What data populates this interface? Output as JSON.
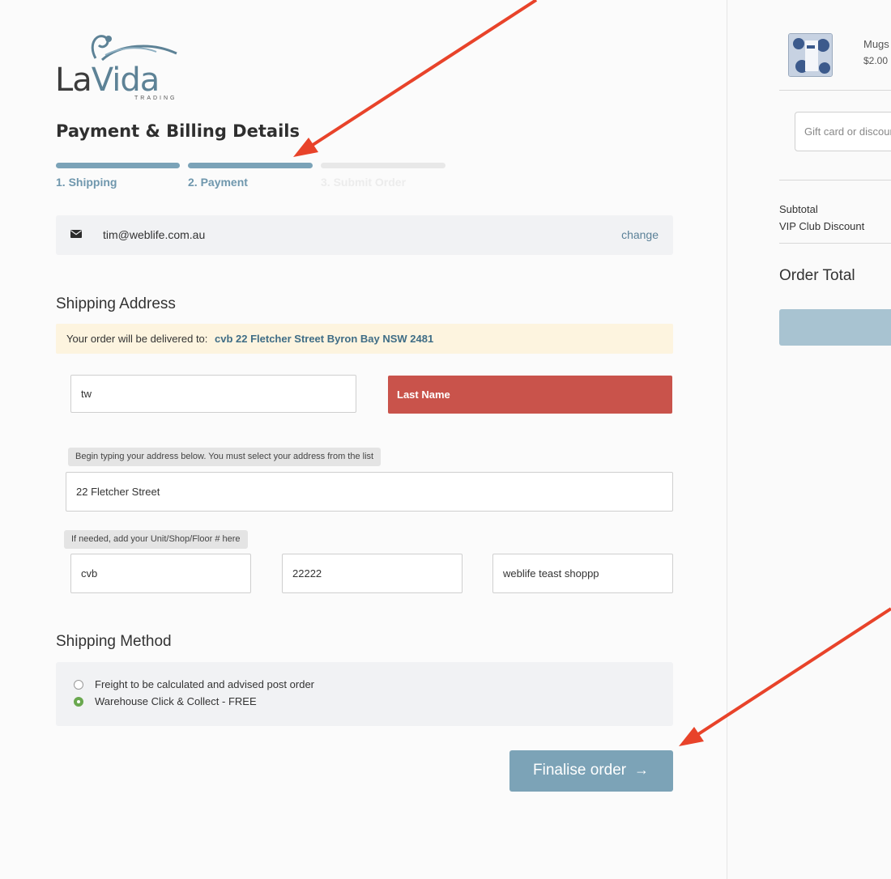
{
  "brand": {
    "logo_main_a": "La",
    "logo_main_b": "Vida",
    "logo_sub": "TRADING"
  },
  "page_title": "Payment & Billing Details",
  "steps": [
    {
      "label": "1. Shipping",
      "state": "complete",
      "color": "#7ba3b8"
    },
    {
      "label": "2. Payment",
      "state": "active",
      "color": "#7ba3b8"
    },
    {
      "label": "3. Submit Order",
      "state": "pending",
      "color": "#e8e8e8"
    }
  ],
  "account": {
    "email": "tim@weblife.com.au",
    "change_label": "change",
    "icon": "envelope-icon"
  },
  "shipping_address": {
    "title": "Shipping Address",
    "delivery_label": "Your order will be delivered to:",
    "delivery_address": "cvb 22 Fletcher Street Byron Bay NSW 2481",
    "first_name_value": "tw",
    "last_name_placeholder": "Last Name",
    "address_tip": "Begin typing your address below. You must select your address from the list",
    "address_value": "22 Fletcher Street",
    "unit_tip": "If needed, add your Unit/Shop/Floor # here",
    "unit_value": "cvb",
    "phone_value": "22222",
    "company_value": "weblife teast shoppp"
  },
  "shipping_method": {
    "title": "Shipping Method",
    "options": [
      {
        "label": "Freight to be calculated and advised post order",
        "selected": false
      },
      {
        "label": "Warehouse Click & Collect - FREE",
        "selected": true
      }
    ]
  },
  "finalise_button": {
    "label": "Finalise order",
    "icon": "arrow-right-icon"
  },
  "order_summary": {
    "product_name": "Mugs",
    "product_price": "$2.00",
    "gift_placeholder": "Gift card or discount code",
    "subtotal_label": "Subtotal",
    "discount_label": "VIP Club Discount",
    "order_total_label": "Order Total"
  },
  "colors": {
    "accent": "#7ca3b7",
    "error": "#c9534b",
    "annotation_arrow": "#e8432a",
    "note_bg": "#fdf4df"
  }
}
